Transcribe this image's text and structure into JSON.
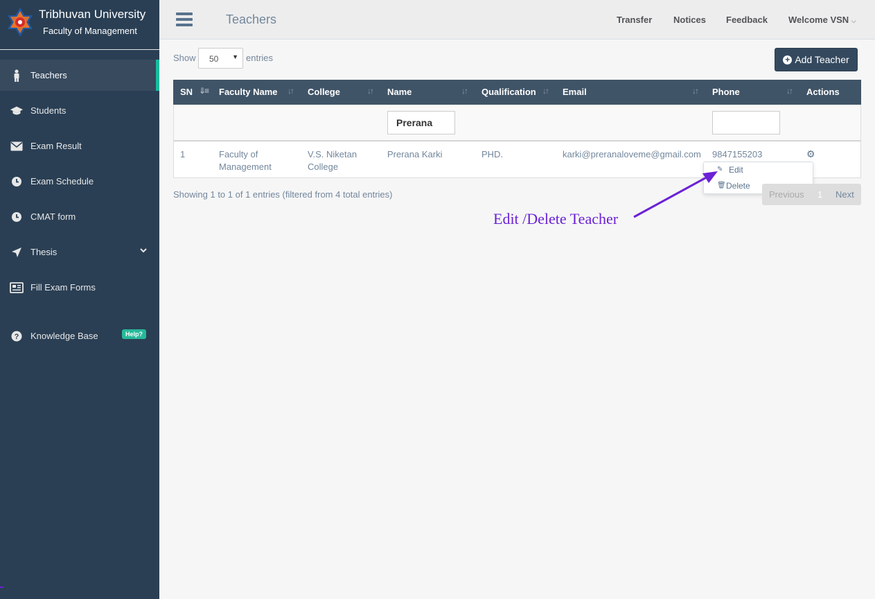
{
  "brand": {
    "title": "Tribhuvan University",
    "subtitle": "Faculty of Management"
  },
  "sidebar": {
    "items": [
      {
        "label": "Teachers",
        "icon": "person-icon"
      },
      {
        "label": "Students",
        "icon": "graduation-cap-icon"
      },
      {
        "label": "Exam Result",
        "icon": "envelope-icon"
      },
      {
        "label": "Exam Schedule",
        "icon": "clock-icon"
      },
      {
        "label": "CMAT form",
        "icon": "clock-icon"
      },
      {
        "label": "Thesis",
        "icon": "paper-plane-icon"
      },
      {
        "label": "Fill Exam Forms",
        "icon": "newspaper-icon"
      }
    ],
    "knowledge_base": {
      "label": "Knowledge Base",
      "badge": "Help?"
    }
  },
  "topnav": {
    "title": "Teachers",
    "links": {
      "transfer": "Transfer",
      "notices": "Notices",
      "feedback": "Feedback",
      "welcome": "Welcome VSN"
    }
  },
  "controls": {
    "show_label": "Show",
    "page_length": "50",
    "entries_label": "entries",
    "add_button": "Add Teacher"
  },
  "table": {
    "headers": [
      "SN",
      "Faculty Name",
      "College",
      "Name",
      "Qualification",
      "Email",
      "Phone",
      "Actions"
    ],
    "filters": {
      "name": "Prerana",
      "phone": ""
    },
    "rows": [
      {
        "sn": "1",
        "faculty_line1": "Faculty of",
        "faculty_line2": "Management",
        "college_line1": "V.S. Niketan",
        "college_line2": "College",
        "name": "Prerana Karki",
        "qualification": "PHD.",
        "email": "karki@preranaloveme@gmail.com",
        "phone": "9847155203"
      }
    ]
  },
  "actions_menu": {
    "edit": "Edit",
    "delete": "Delete"
  },
  "footer": {
    "info": "Showing 1 to 1 of 1 entries (filtered from 4 total entries)",
    "previous": "Previous",
    "page": "1",
    "next": "Next"
  },
  "annotation": {
    "text": "Edit /Delete Teacher",
    "color": "#6b21d6"
  },
  "colors": {
    "sidebar": "#2a3f54",
    "accent": "#1abb9c",
    "header": "#405467",
    "button": "#34495e"
  }
}
